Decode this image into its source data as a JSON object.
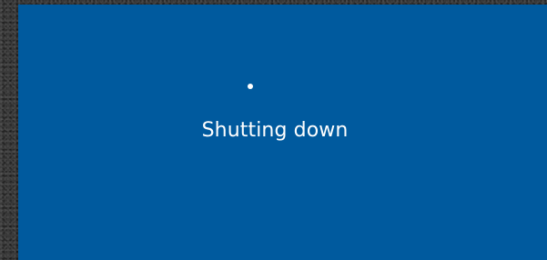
{
  "screen": {
    "status_text": "Shutting down",
    "background_color": "#005a9e",
    "text_color": "#ffffff",
    "spinner_icon": "loading-spinner-icon"
  }
}
